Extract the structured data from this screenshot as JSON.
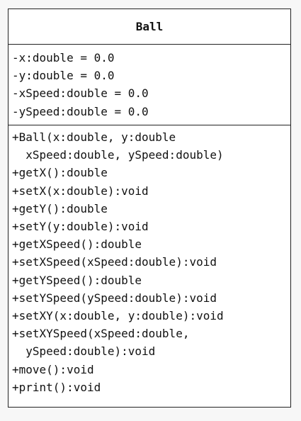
{
  "class": {
    "name": "Ball",
    "attributes": [
      "-x:double = 0.0",
      "-y:double = 0.0",
      "-xSpeed:double = 0.0",
      "-ySpeed:double = 0.0"
    ],
    "operations": [
      "+Ball(x:double, y:double",
      "  xSpeed:double, ySpeed:double)",
      "+getX():double",
      "+setX(x:double):void",
      "+getY():double",
      "+setY(y:double):void",
      "+getXSpeed():double",
      "+setXSpeed(xSpeed:double):void",
      "+getYSpeed():double",
      "+setYSpeed(ySpeed:double):void",
      "+setXY(x:double, y:double):void",
      "+setXYSpeed(xSpeed:double,",
      "  ySpeed:double):void",
      "+move():void",
      "+print():void"
    ]
  }
}
